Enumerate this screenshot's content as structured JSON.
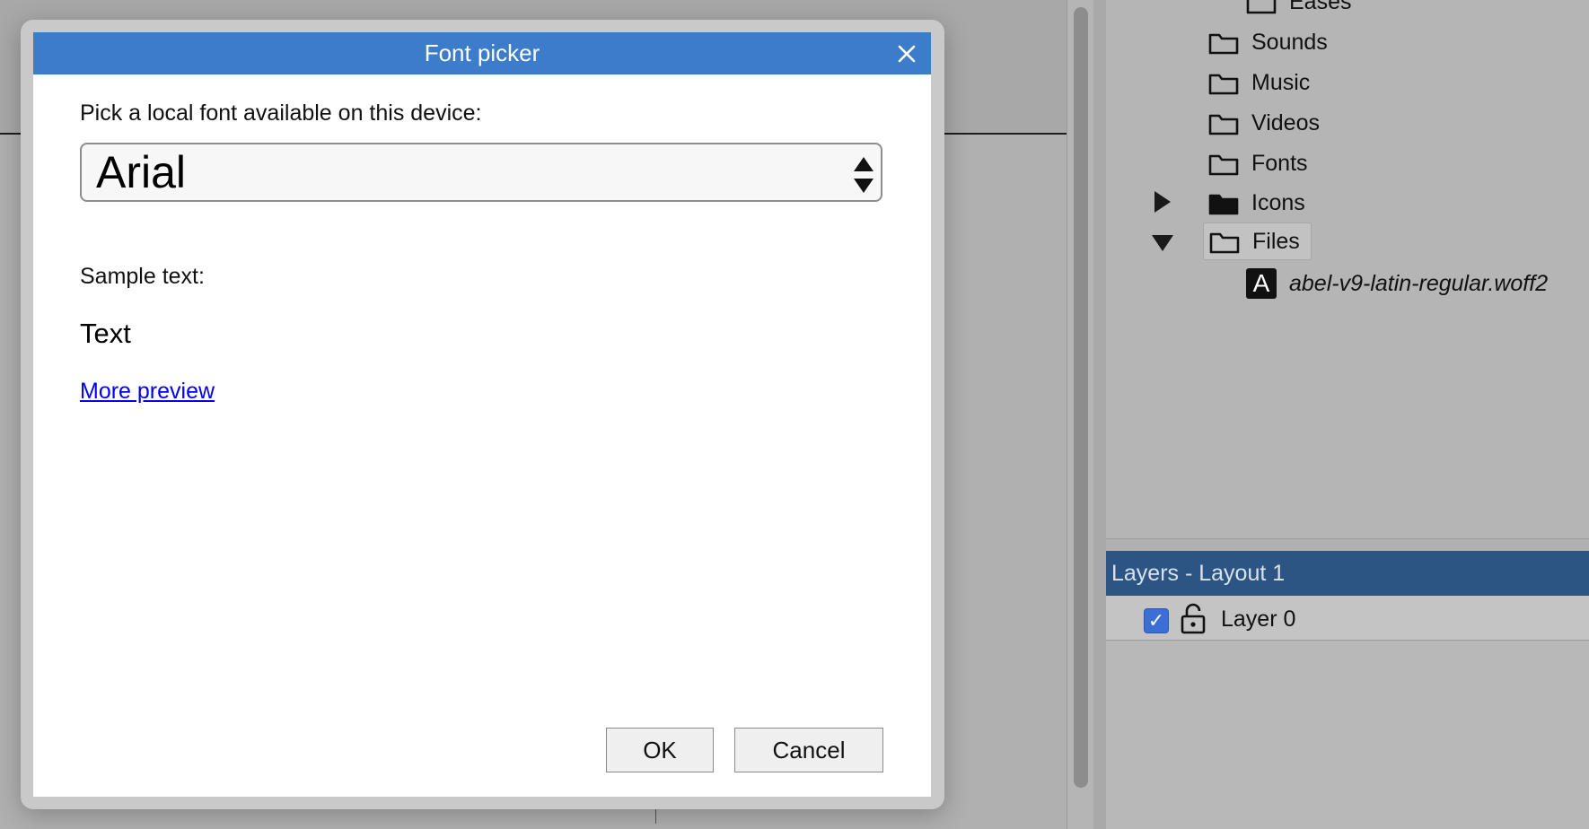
{
  "dialog": {
    "title": "Font picker",
    "pick_label": "Pick a local font available on this device:",
    "selected_font": "Arial",
    "sample_label": "Sample text:",
    "sample_text": "Text",
    "more_preview": "More preview",
    "ok_label": "OK",
    "cancel_label": "Cancel"
  },
  "project_tree": {
    "items": [
      {
        "label": "Eases",
        "icon": "folder-icon"
      },
      {
        "label": "Sounds",
        "icon": "folder-icon"
      },
      {
        "label": "Music",
        "icon": "folder-icon"
      },
      {
        "label": "Videos",
        "icon": "folder-icon"
      },
      {
        "label": "Fonts",
        "icon": "folder-icon"
      },
      {
        "label": "Icons",
        "icon": "folder-filled-icon",
        "expanded": false
      },
      {
        "label": "Files",
        "icon": "folder-icon",
        "expanded": true,
        "selected": true
      },
      {
        "label": "abel-v9-latin-regular.woff2",
        "icon": "font-file-icon"
      }
    ]
  },
  "layers": {
    "header": "Layers - Layout 1",
    "rows": [
      {
        "name": "Layer 0",
        "visible": true,
        "locked": false
      }
    ]
  },
  "colors": {
    "dialog_titlebar": "#3d7cc9",
    "layers_header": "#2d5584",
    "checkbox": "#3b6fd6",
    "link": "#0000ee"
  }
}
